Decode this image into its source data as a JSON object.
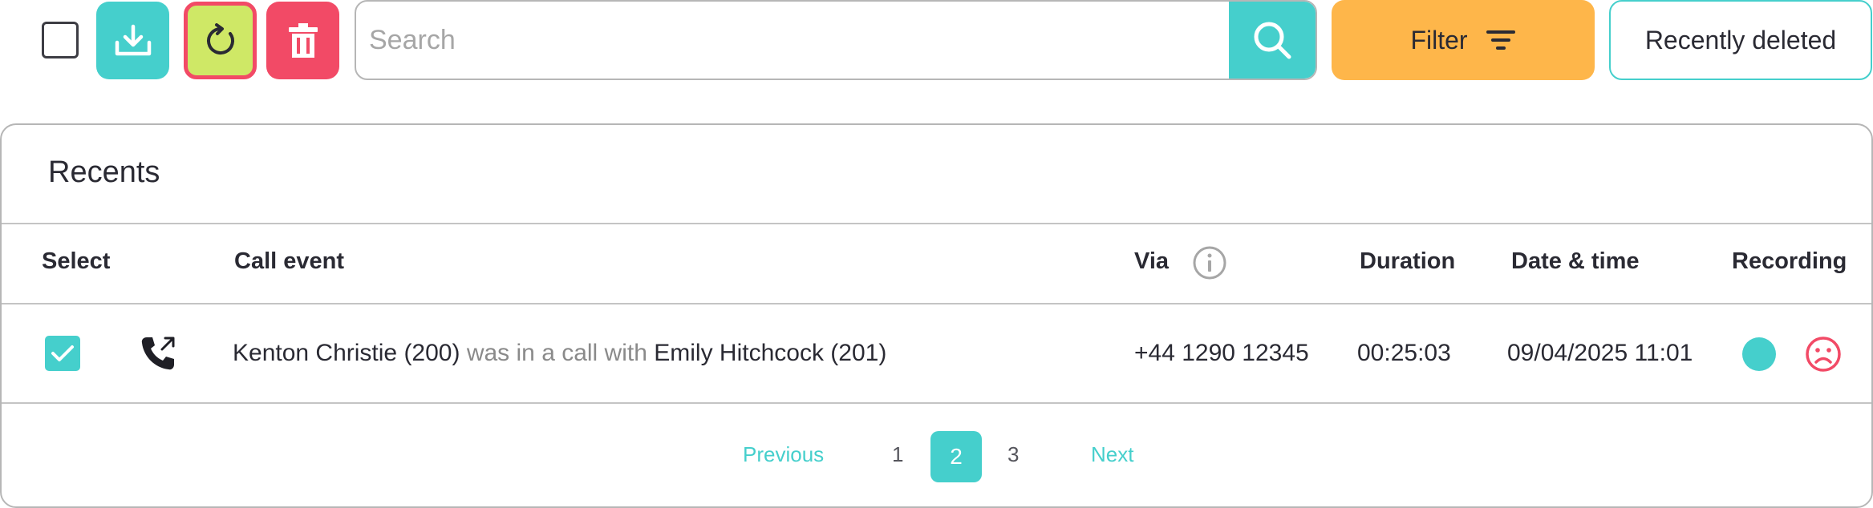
{
  "toolbar": {
    "search_placeholder": "Search",
    "filter_label": "Filter",
    "recently_deleted_label": "Recently deleted"
  },
  "colors": {
    "accent": "#45cfcc",
    "refresh_bg": "#cfe866",
    "danger": "#f24a66",
    "filter_bg": "#feb64a"
  },
  "icons": [
    "download-icon",
    "refresh-icon",
    "trash-icon",
    "search-icon",
    "filter-lines-icon",
    "info-icon",
    "outgoing-call-icon",
    "check-icon",
    "sad-face-icon"
  ],
  "card": {
    "title": "Recents",
    "columns": {
      "select": "Select",
      "call_event": "Call event",
      "via": "Via",
      "duration": "Duration",
      "datetime": "Date & time",
      "recording": "Recording"
    }
  },
  "rows": [
    {
      "selected": true,
      "caller": "Kenton Christie (200)",
      "connector": " was in a call with ",
      "callee": "Emily Hitchcock (201)",
      "via": "+44 1290 12345",
      "duration": "00:25:03",
      "datetime": "09/04/2025 11:01"
    }
  ],
  "pagination": {
    "previous": "Previous",
    "pages": [
      "1",
      "2",
      "3"
    ],
    "current": "2",
    "next": "Next"
  }
}
